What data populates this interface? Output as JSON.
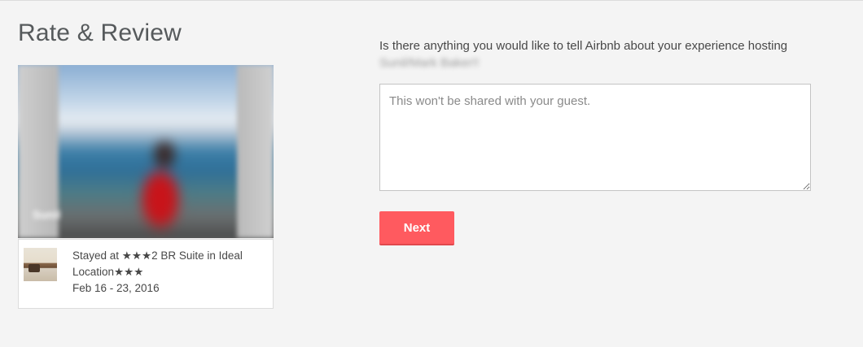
{
  "page": {
    "title": "Rate & Review"
  },
  "guest": {
    "photo_name": "Sunil"
  },
  "listing": {
    "stay_text": "Stayed at ★★★2 BR Suite in Ideal Location★★★",
    "dates": "Feb 16 - 23, 2016"
  },
  "form": {
    "question_prefix": "Is there anything you would like to tell Airbnb about your experience hosting",
    "host_name": "Sunil/Mark Baker!!",
    "placeholder": "This won't be shared with your guest.",
    "value": "",
    "next_label": "Next"
  },
  "colors": {
    "accent": "#ff5a5f",
    "background": "#f4f4f4",
    "text": "#484848"
  }
}
